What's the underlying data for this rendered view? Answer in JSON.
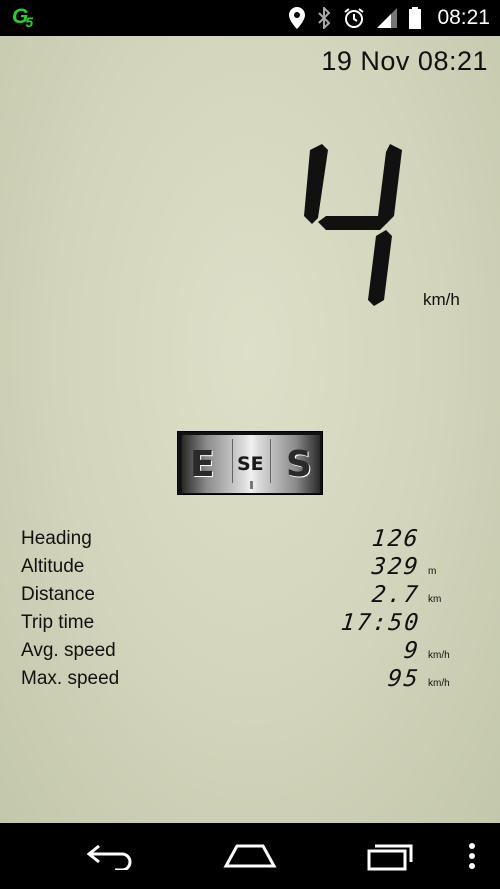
{
  "status_bar": {
    "app_logo": "G",
    "app_logo_sub": "5",
    "time": "08:21",
    "icons": [
      "location-icon",
      "bluetooth-icon",
      "alarm-icon",
      "signal-icon",
      "battery-icon"
    ],
    "logo_color": "#2ecc2e"
  },
  "header": {
    "datetime": "19 Nov 08:21"
  },
  "speed": {
    "value": "4",
    "unit": "km/h"
  },
  "compass": {
    "left": "E",
    "center": "SE",
    "right": "S"
  },
  "stats": [
    {
      "label": "Heading",
      "value": "126",
      "unit": ""
    },
    {
      "label": "Altitude",
      "value": "329",
      "unit": "m"
    },
    {
      "label": "Distance",
      "value": "2.7",
      "unit": "km"
    },
    {
      "label": "Trip time",
      "value": "17:50",
      "unit": ""
    },
    {
      "label": "Avg. speed",
      "value": "9",
      "unit": "km/h"
    },
    {
      "label": "Max. speed",
      "value": "95",
      "unit": "km/h"
    }
  ],
  "nav_bar": {
    "buttons": [
      "back-icon",
      "home-icon",
      "recents-icon",
      "overflow-menu-icon"
    ]
  }
}
